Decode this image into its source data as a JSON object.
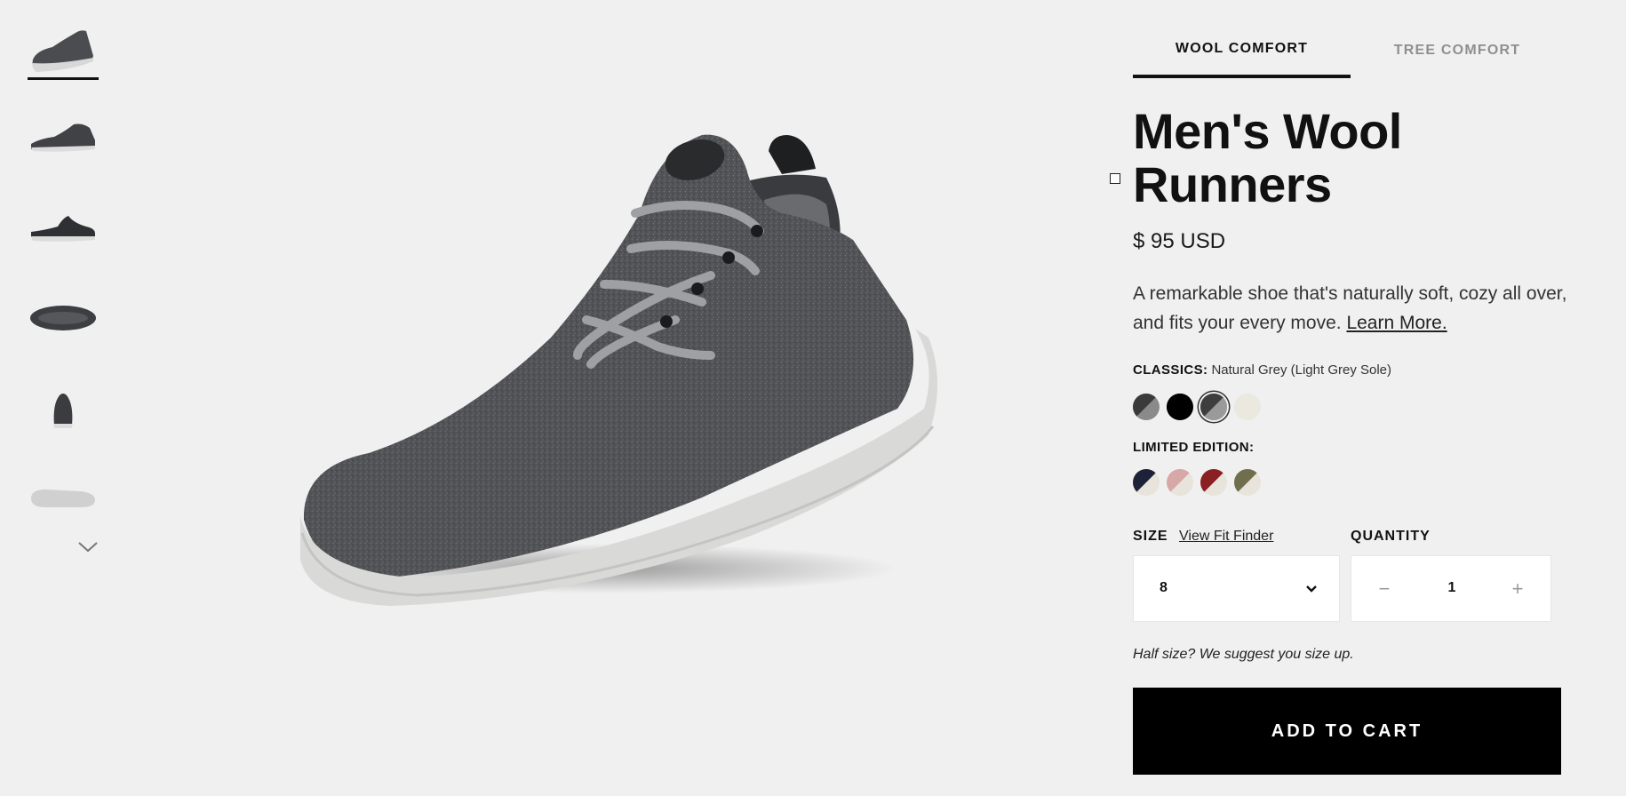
{
  "thumbnails": [
    {
      "name": "thumb-angle-view",
      "selected": true
    },
    {
      "name": "thumb-side-view",
      "selected": false
    },
    {
      "name": "thumb-side-view-alt",
      "selected": false
    },
    {
      "name": "thumb-top-view",
      "selected": false
    },
    {
      "name": "thumb-back-view",
      "selected": false
    },
    {
      "name": "thumb-sole-view",
      "selected": false
    }
  ],
  "thumbnail_scroll_icon": "chevron-down-icon",
  "tabs": [
    {
      "label": "WOOL COMFORT",
      "active": true
    },
    {
      "label": "TREE COMFORT",
      "active": false
    }
  ],
  "product": {
    "title": "Men's Wool Runners",
    "price": "$ 95 USD",
    "description": "A remarkable shoe that's naturally soft, cozy all over, and fits your every move.",
    "learn_more": "Learn More."
  },
  "classics": {
    "label": "CLASSICS:",
    "selected_name": "Natural Grey (Light Grey Sole)",
    "swatches": [
      {
        "top": "#3a3a3a",
        "bottom": "#8a8a8a",
        "selected": false
      },
      {
        "top": "#000000",
        "bottom": "#000000",
        "selected": false
      },
      {
        "top": "#3e3e3e",
        "bottom": "#9a9a9a",
        "selected": true
      },
      {
        "top": "#ebe8e0",
        "bottom": "#ebe8e0",
        "selected": false
      }
    ]
  },
  "limited": {
    "label": "LIMITED EDITION:",
    "swatches": [
      {
        "top": "#1d2238",
        "bottom": "#e8e4dc",
        "selected": false
      },
      {
        "top": "#d8a7a7",
        "bottom": "#e8e4dc",
        "selected": false
      },
      {
        "top": "#8a1f24",
        "bottom": "#e8e4dc",
        "selected": false
      },
      {
        "top": "#6f6f4e",
        "bottom": "#e8e4dc",
        "selected": false
      }
    ]
  },
  "size": {
    "label": "SIZE",
    "fit_finder": "View Fit Finder",
    "value": "8"
  },
  "quantity": {
    "label": "QUANTITY",
    "minus": "−",
    "value": "1",
    "plus": "+"
  },
  "hint": "Half size? We suggest you size up.",
  "add_to_cart": "ADD TO CART"
}
